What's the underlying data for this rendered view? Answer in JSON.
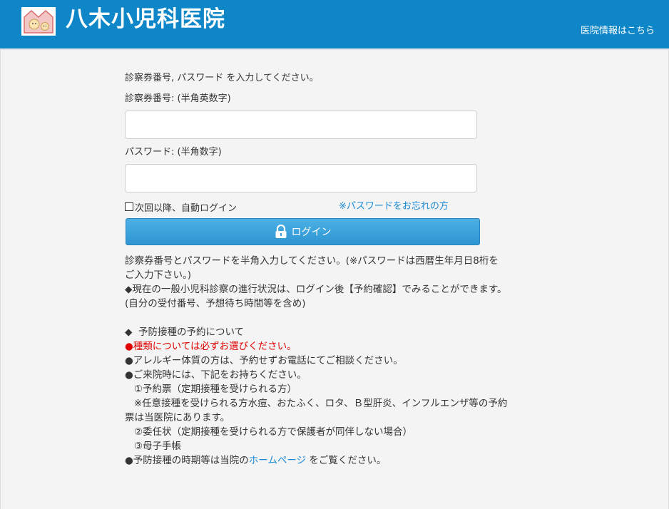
{
  "header": {
    "title": "八木小児科医院",
    "info_link": "医院情報はこちら",
    "logo_icon": "kids-house-logo",
    "bg_color": "#0e86c8"
  },
  "form": {
    "intro": "診察券番号, パスワード を入力してください。",
    "card_label": "診察券番号: (半角英数字)",
    "card_value": "",
    "password_label": "パスワード: (半角数字)",
    "password_value": "",
    "remember_label": "次回以降、自動ログイン",
    "forgot_link": "※パスワードをお忘れの方",
    "login_button": "ログイン",
    "login_icon": "lock-icon"
  },
  "info": {
    "line1": "診察券番号とパスワードを半角入力してください。(※パスワードは西暦生年月日8桁を",
    "line2": "ご入力下さい。)",
    "line3": "◆現在の一般小児科診察の進行状況は、ログイン後【予約確認】でみることができます。",
    "line4": "(自分の受付番号、予想待ち時間等を含め)",
    "line5": "◆  予防接種の予約について",
    "line6": "●種類については必ずお選びください。",
    "line7": "●アレルギー体質の方は、予約せずお電話にてご相談ください。",
    "line8": "●ご来院時には、下記をお持ちください。",
    "line9": "   ①予約票（定期接種を受けられる方）",
    "line10": "   ※任意接種を受けられる方水痘、おたふく、ロタ、Ｂ型肝炎、インフルエンザ等の予約",
    "line11": "票は当医院にあります。",
    "line12": "   ②委任状（定期接種を受けられる方で保護者が同伴しない場合）",
    "line13": "   ③母子手帳",
    "line14_prefix": "●予防接種の時期等は当院の",
    "line14_link": "ホームページ",
    "line14_suffix": " をご覧ください。"
  }
}
